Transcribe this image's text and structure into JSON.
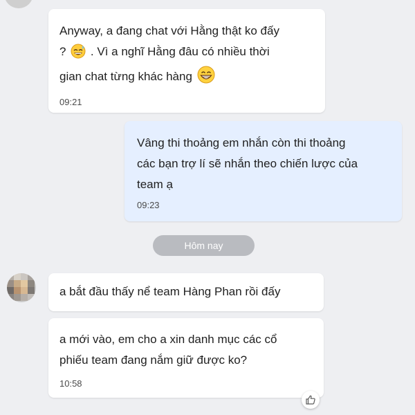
{
  "messages": [
    {
      "direction": "incoming",
      "text_part1": "Anyway, a đang chat với Hằng thật ko đấy",
      "text_part2": "? ",
      "text_part3": " . Vì a nghĩ Hằng đâu có nhiều thời",
      "text_part4": "gian chat từng khác hàng ",
      "emoji_1": "sweat-smile-icon",
      "emoji_2": "grin-icon",
      "time": "09:21"
    },
    {
      "direction": "outgoing",
      "text": "Vâng thi thoảng em nhắn còn thi thoảng\ncác bạn trợ lí sẽ nhắn theo chiến lược của\nteam ạ",
      "time": "09:23"
    },
    {
      "direction": "incoming",
      "text": "a bắt đầu thấy nể team Hàng Phan rồi đấy"
    },
    {
      "direction": "incoming",
      "text": "a mới vào, em cho a xin danh mục các cổ\nphiếu team đang nắm giữ được ko?",
      "time": "10:58"
    }
  ],
  "date_separator": "Hôm nay",
  "colors": {
    "background": "#eeeff2",
    "incoming_bubble": "#ffffff",
    "outgoing_bubble": "#e5efff",
    "date_pill": "#b9bbc0"
  }
}
